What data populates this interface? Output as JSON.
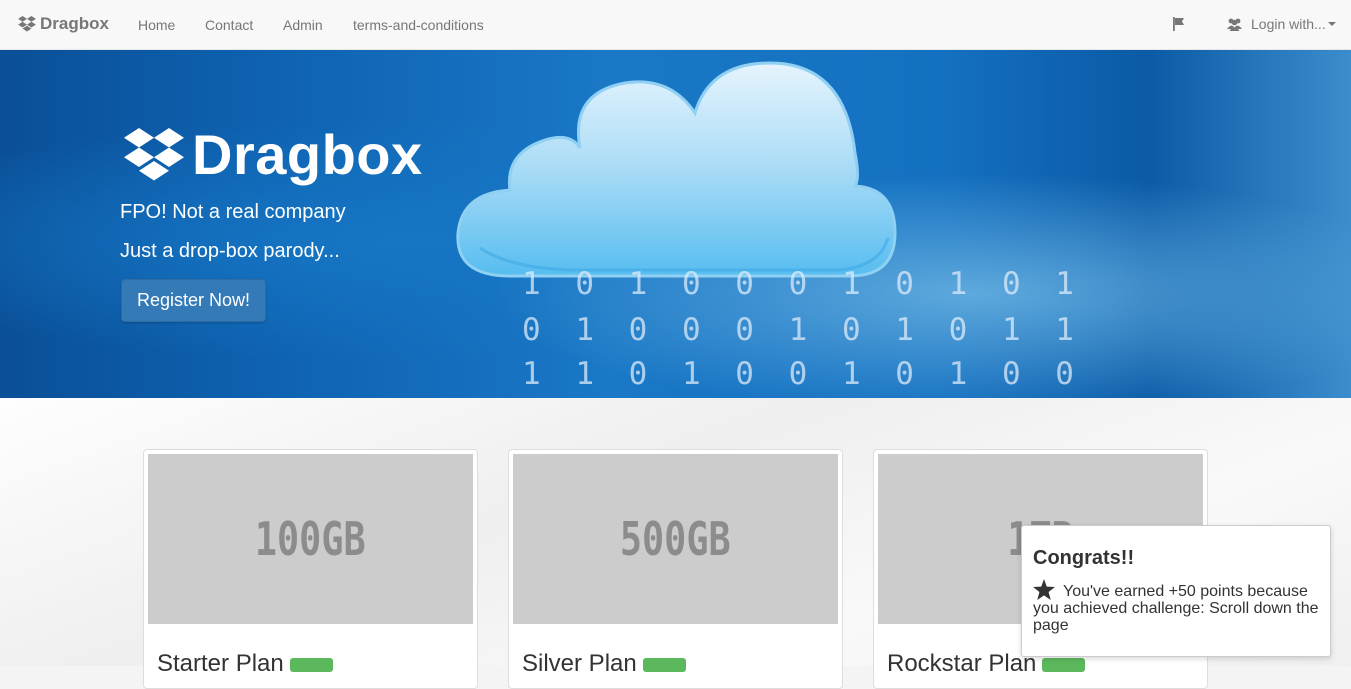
{
  "navbar": {
    "brand": "Dragbox",
    "links": [
      "Home",
      "Contact",
      "Admin",
      "terms-and-conditions"
    ],
    "flag_icon": "flag-icon",
    "login_label": "Login with..."
  },
  "hero": {
    "logo_text": "Dragbox",
    "tagline1": "FPO! Not a real company",
    "tagline2": "Just a drop-box parody...",
    "register_label": "Register Now!",
    "binary": [
      "1 0 1 0 0 0 1 0 1 0 1",
      "0 1 0 0 0 1 0 1 0 1 1",
      "1 1 0 1 0 0 1 0 1 0 0"
    ]
  },
  "plans": [
    {
      "image_text": "100GB",
      "title": "Starter Plan"
    },
    {
      "image_text": "500GB",
      "title": "Silver Plan"
    },
    {
      "image_text": "1TB",
      "title": "Rockstar Plan"
    }
  ],
  "toast": {
    "title": "Congrats!!",
    "message": "You've earned +50 points because you achieved challenge: Scroll down the page"
  }
}
